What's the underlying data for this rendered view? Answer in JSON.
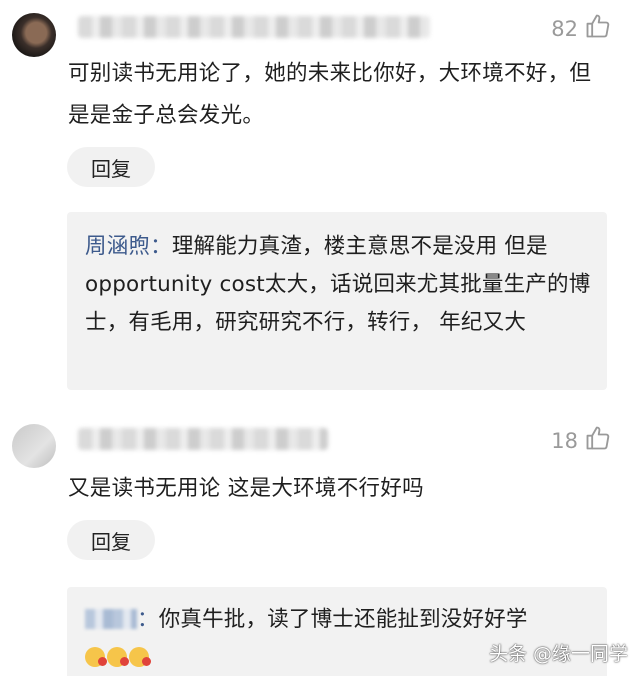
{
  "comments": [
    {
      "likes": "82",
      "text": "可别读书无用论了，她的未来比你好，大环境不好，但是是金子总会发光。",
      "reply_label": "回复",
      "reply": {
        "author": "周涵煦：",
        "text": "理解能力真渣，楼主意思不是没用 但是opportunity cost太大，话说回来尤其批量生产的博士，有毛用，研究研究不行，转行， 年纪又大"
      }
    },
    {
      "likes": "18",
      "text": "又是读书无用论 这是大环境不行好吗",
      "reply_label": "回复",
      "reply": {
        "author": "：",
        "text": "你真牛批，读了博士还能扯到没好好学"
      }
    }
  ],
  "watermark": "头条 @缘一同学",
  "icons": {
    "like": "thumbs-up-icon"
  }
}
